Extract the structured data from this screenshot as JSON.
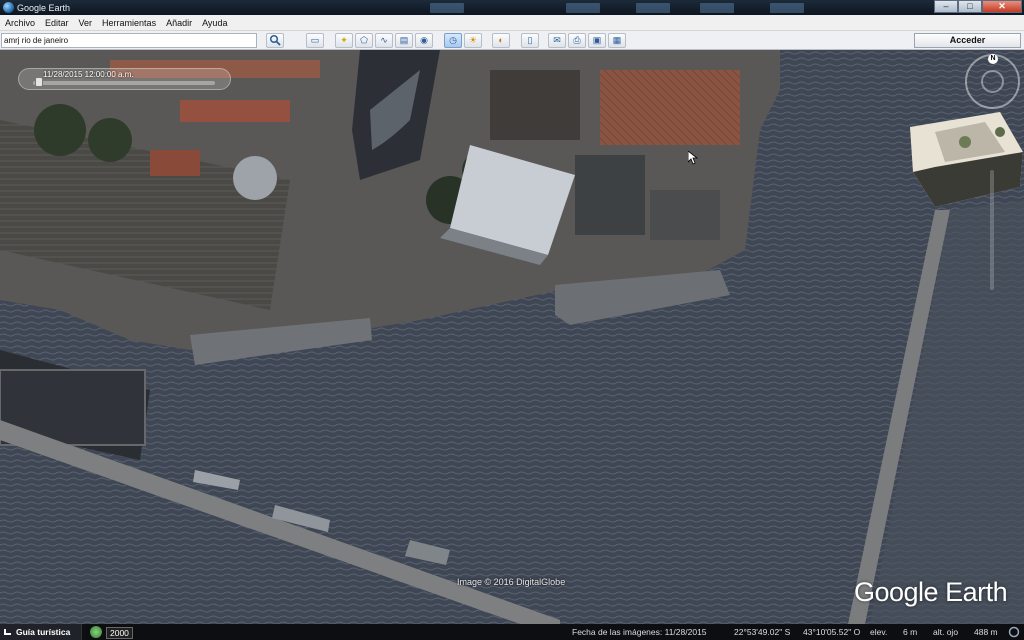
{
  "window": {
    "title": "Google Earth",
    "controls": [
      "–",
      "□",
      "✕"
    ]
  },
  "menu": [
    "Archivo",
    "Editar",
    "Ver",
    "Herramientas",
    "Añadir",
    "Ayuda"
  ],
  "search": {
    "value": "amrj rio de janeiro"
  },
  "toolbar": {
    "login_label": "Acceder"
  },
  "timeslider": {
    "label": "11/28/2015  12:00:00 a.m."
  },
  "compass": {
    "north_label": "N"
  },
  "map": {
    "image_credit": "Image © 2016 DigitalGlobe",
    "logo": "Google Earth"
  },
  "statusbar": {
    "tour_label": "Guía turística",
    "historical_year": "2000",
    "image_date": "Fecha de las imágenes: 11/28/2015",
    "lat": "22°53'49.02\" S",
    "lon": "43°10'05.52\" O",
    "elev_label": "elev.",
    "elev_value": "6 m",
    "eye_alt_label": "alt. ojo",
    "eye_alt_value": "488 m"
  }
}
